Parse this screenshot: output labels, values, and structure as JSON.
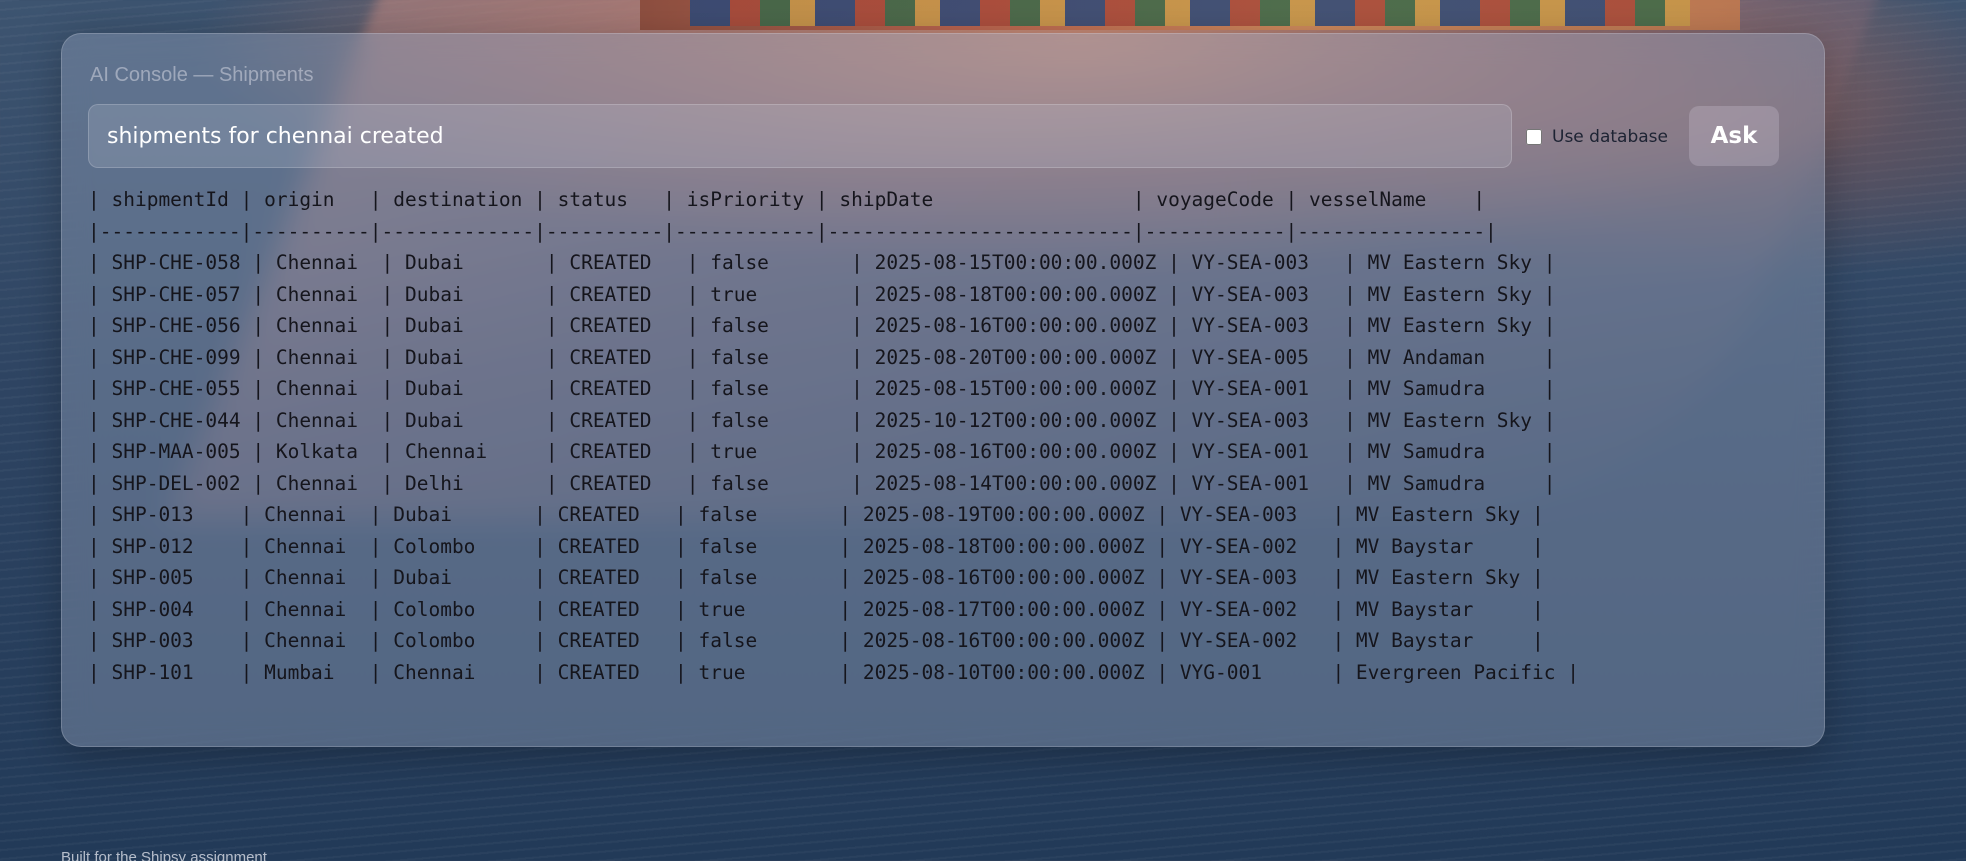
{
  "panel": {
    "title": "AI Console — Shipments"
  },
  "query": {
    "value": "shipments for chennai created"
  },
  "controls": {
    "use_database_label": "Use database",
    "use_database_checked": false,
    "ask_label": "Ask"
  },
  "result": {
    "header": "| shipmentId | origin   | destination | status   | isPriority | shipDate                 | voyageCode | vesselName    |",
    "separator": "|------------|----------|-------------|----------|------------|--------------------------|------------|----------------|",
    "rows": [
      "| SHP-CHE-058 | Chennai  | Dubai       | CREATED   | false       | 2025-08-15T00:00:00.000Z | VY-SEA-003   | MV Eastern Sky |",
      "| SHP-CHE-057 | Chennai  | Dubai       | CREATED   | true        | 2025-08-18T00:00:00.000Z | VY-SEA-003   | MV Eastern Sky |",
      "| SHP-CHE-056 | Chennai  | Dubai       | CREATED   | false       | 2025-08-16T00:00:00.000Z | VY-SEA-003   | MV Eastern Sky |",
      "| SHP-CHE-099 | Chennai  | Dubai       | CREATED   | false       | 2025-08-20T00:00:00.000Z | VY-SEA-005   | MV Andaman     |",
      "| SHP-CHE-055 | Chennai  | Dubai       | CREATED   | false       | 2025-08-15T00:00:00.000Z | VY-SEA-001   | MV Samudra     |",
      "| SHP-CHE-044 | Chennai  | Dubai       | CREATED   | false       | 2025-10-12T00:00:00.000Z | VY-SEA-003   | MV Eastern Sky |",
      "| SHP-MAA-005 | Kolkata  | Chennai     | CREATED   | true        | 2025-08-16T00:00:00.000Z | VY-SEA-001   | MV Samudra     |",
      "| SHP-DEL-002 | Chennai  | Delhi       | CREATED   | false       | 2025-08-14T00:00:00.000Z | VY-SEA-001   | MV Samudra     |",
      "| SHP-013    | Chennai  | Dubai       | CREATED   | false       | 2025-08-19T00:00:00.000Z | VY-SEA-003   | MV Eastern Sky |",
      "| SHP-012    | Chennai  | Colombo     | CREATED   | false       | 2025-08-18T00:00:00.000Z | VY-SEA-002   | MV Baystar     |",
      "| SHP-005    | Chennai  | Dubai       | CREATED   | false       | 2025-08-16T00:00:00.000Z | VY-SEA-003   | MV Eastern Sky |",
      "| SHP-004    | Chennai  | Colombo     | CREATED   | true        | 2025-08-17T00:00:00.000Z | VY-SEA-002   | MV Baystar     |",
      "| SHP-003    | Chennai  | Colombo     | CREATED   | false       | 2025-08-16T00:00:00.000Z | VY-SEA-002   | MV Baystar     |",
      "| SHP-101    | Mumbai   | Chennai     | CREATED   | true        | 2025-08-10T00:00:00.000Z | VYG-001      | Evergreen Pacific |"
    ]
  },
  "footer": {
    "text": "Built for the Shipsy assignment"
  }
}
